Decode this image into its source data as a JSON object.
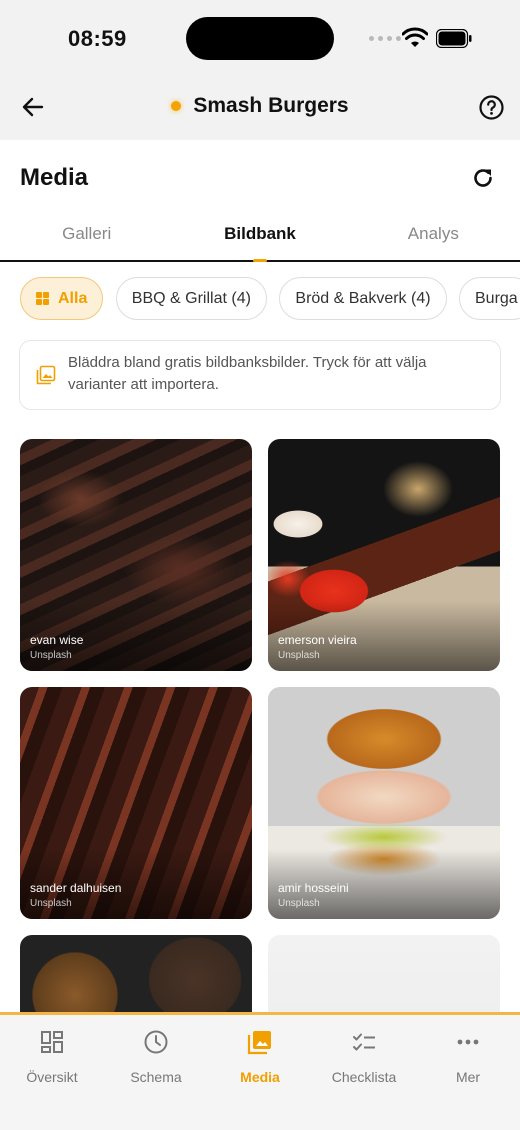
{
  "status_bar": {
    "time": "08:59"
  },
  "header": {
    "title": "Smash Burgers"
  },
  "section": {
    "title": "Media"
  },
  "tabs": [
    {
      "label": "Galleri",
      "active": false
    },
    {
      "label": "Bildbank",
      "active": true
    },
    {
      "label": "Analys",
      "active": false
    }
  ],
  "filters": [
    {
      "label": "Alla",
      "active": true,
      "icon": "grid-icon"
    },
    {
      "label": "BBQ & Grillat (4)",
      "active": false
    },
    {
      "label": "Bröd & Bakverk (4)",
      "active": false
    },
    {
      "label": "Burga",
      "active": false
    }
  ],
  "info": {
    "text": "Bläddra bland gratis bildbanksbilder. Tryck för att välja varianter att importera.",
    "icon": "image-library-icon"
  },
  "photos": [
    {
      "author": "evan wise",
      "source": "Unsplash"
    },
    {
      "author": "emerson vieira",
      "source": "Unsplash"
    },
    {
      "author": "sander dalhuisen",
      "source": "Unsplash"
    },
    {
      "author": "amir hosseini",
      "source": "Unsplash"
    }
  ],
  "bottom_nav": [
    {
      "label": "Översikt",
      "icon": "dashboard-icon",
      "active": false
    },
    {
      "label": "Schema",
      "icon": "clock-icon",
      "active": false
    },
    {
      "label": "Media",
      "icon": "photo-library-icon",
      "active": true
    },
    {
      "label": "Checklista",
      "icon": "checklist-icon",
      "active": false
    },
    {
      "label": "Mer",
      "icon": "more-dots-icon",
      "active": false
    }
  ],
  "colors": {
    "accent": "#f0a000",
    "accent_soft": "#fdf0d8",
    "text": "#111111",
    "muted": "#888888"
  }
}
